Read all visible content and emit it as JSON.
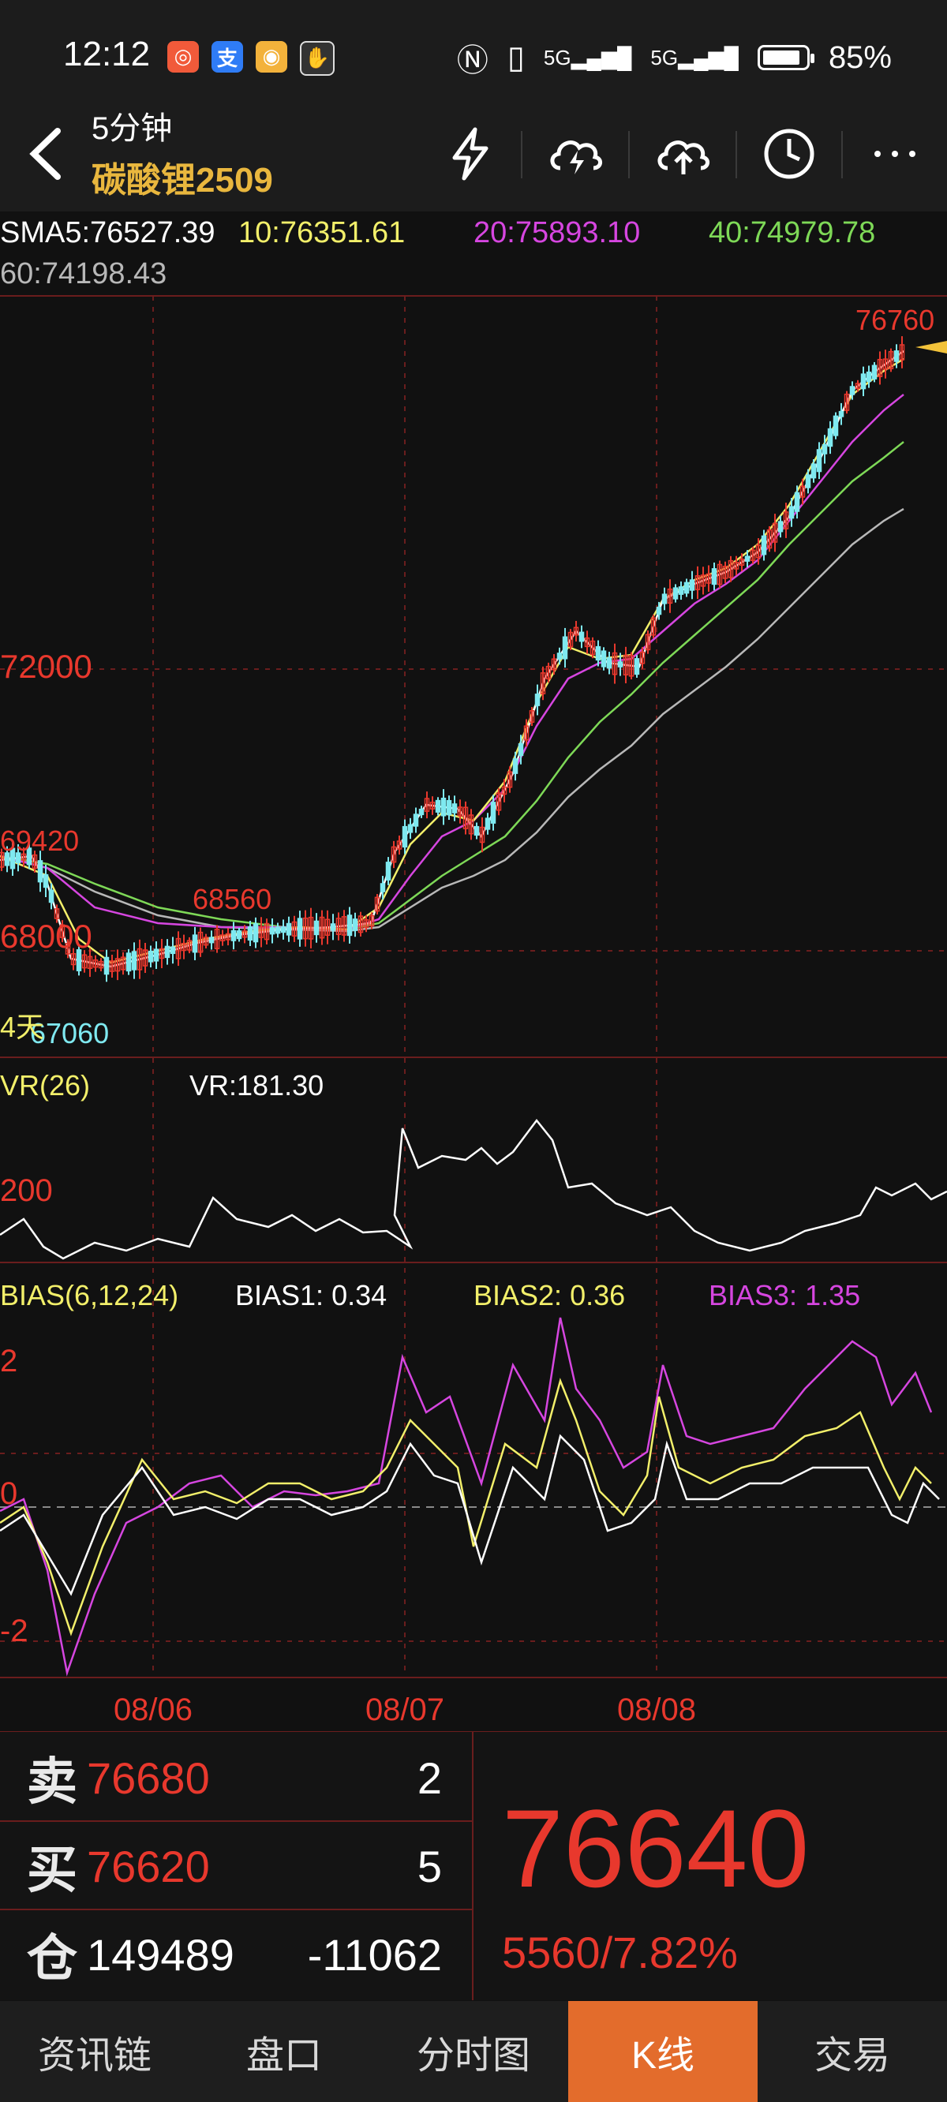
{
  "status_bar": {
    "time": "12:12",
    "battery": "85%",
    "signal_1": "5G",
    "signal_2": "5G",
    "app_icons": [
      "notification-app-icon",
      "alipay-icon",
      "weibo-icon",
      "gesture-icon"
    ]
  },
  "header": {
    "period": "5分钟",
    "contract": "碳酸锂2509",
    "tools": [
      "flash-icon",
      "cloud-flash-icon",
      "cloud-upload-icon",
      "clock-icon",
      "more-icon"
    ]
  },
  "ma": {
    "sma5": "SMA5:76527.39",
    "ma10": "10:76351.61",
    "ma20": "20:75893.10",
    "ma40": "40:74979.78",
    "ma60": "60:74198.43"
  },
  "price_chart": {
    "label_72000": "72000",
    "label_68000": "68000",
    "high_mark": "76760",
    "mark_69420": "69420",
    "mark_68560": "68560",
    "low_mark": "67060",
    "days_label": "4天"
  },
  "vr": {
    "title": "VR(26)",
    "value": "VR:181.30",
    "axis_200": "200"
  },
  "bias": {
    "title": "BIAS(6,12,24)",
    "bias1": "BIAS1: 0.34",
    "bias2": "BIAS2: 0.36",
    "bias3": "BIAS3: 1.35",
    "axis_2": "2",
    "axis_0": "0",
    "axis_neg2": "-2"
  },
  "dates": [
    "08/06",
    "08/07",
    "08/08"
  ],
  "quote": {
    "sell_label": "卖",
    "sell_price": "76680",
    "sell_vol": "2",
    "buy_label": "买",
    "buy_price": "76620",
    "buy_vol": "5",
    "oi_label": "仓",
    "oi_value": "149489",
    "oi_change": "-11062",
    "last_price": "76640",
    "change": "5560/7.82%"
  },
  "tabs": [
    "资讯链",
    "盘口",
    "分时图",
    "K线",
    "交易"
  ],
  "active_tab": "K线",
  "colors": {
    "up": "#e8382d",
    "ma5": "#ffffff",
    "ma10": "#f2ef6a",
    "ma20": "#d646e0",
    "ma40": "#7ed957",
    "ma60": "#b8b8b8",
    "accent": "#e36c2c"
  }
}
